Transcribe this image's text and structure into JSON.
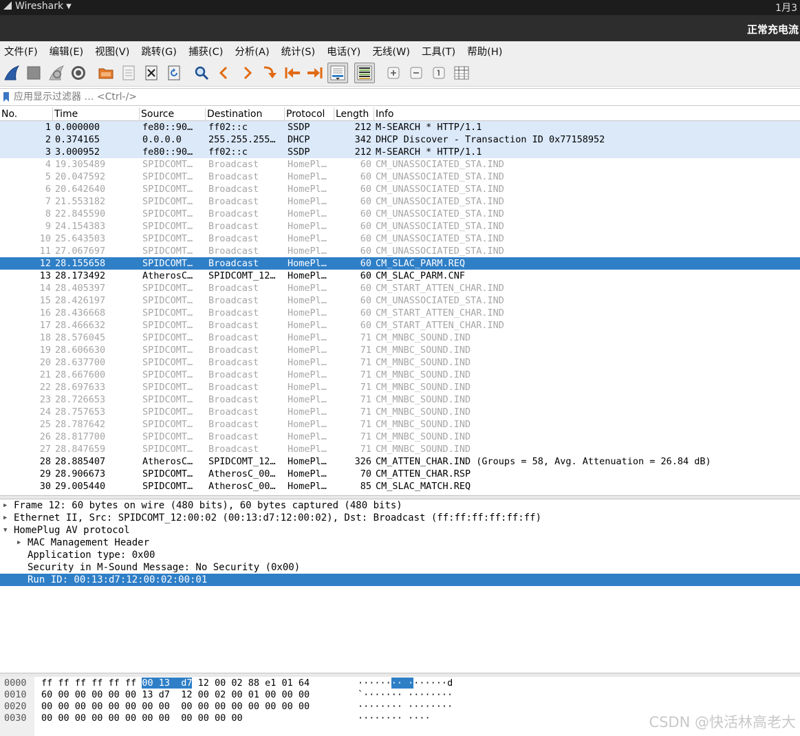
{
  "system": {
    "app_name": "Wireshark",
    "clock": "1月3"
  },
  "window": {
    "title": "正常充电流"
  },
  "menu": [
    "文件(F)",
    "编辑(E)",
    "视图(V)",
    "跳转(G)",
    "捕获(C)",
    "分析(A)",
    "统计(S)",
    "电话(Y)",
    "无线(W)",
    "工具(T)",
    "帮助(H)"
  ],
  "toolbar_icons": [
    "shark-fin-start-icon",
    "stop-square-icon",
    "restart-fin-icon",
    "gear-options-icon",
    "open-folder-icon",
    "save-file-icon",
    "close-file-icon",
    "reload-icon",
    "find-magnifier-icon",
    "arrow-left-icon",
    "arrow-right-icon",
    "jump-to-icon",
    "first-packet-icon",
    "last-packet-icon",
    "autoscroll-icon",
    "colorize-icon",
    "zoom-in-icon",
    "zoom-out-icon",
    "normal-size-icon",
    "resize-columns-icon"
  ],
  "filter": {
    "placeholder": "应用显示过滤器 … <Ctrl-/>",
    "value": ""
  },
  "packet_list": {
    "columns": [
      "No.",
      "Time",
      "Source",
      "Destination",
      "Protocol",
      "Length",
      "Info"
    ],
    "rows": [
      {
        "no": "1",
        "time": "0.000000",
        "src": "fe80::90…",
        "dst": "ff02::c",
        "proto": "SSDP",
        "len": "212",
        "info": "M-SEARCH * HTTP/1.1",
        "style": "udp"
      },
      {
        "no": "2",
        "time": "0.374165",
        "src": "0.0.0.0",
        "dst": "255.255.255…",
        "proto": "DHCP",
        "len": "342",
        "info": "DHCP Discover - Transaction ID 0x77158952",
        "style": "udp"
      },
      {
        "no": "3",
        "time": "3.000952",
        "src": "fe80::90…",
        "dst": "ff02::c",
        "proto": "SSDP",
        "len": "212",
        "info": "M-SEARCH * HTTP/1.1",
        "style": "udp"
      },
      {
        "no": "4",
        "time": "19.305489",
        "src": "SPIDCOMT…",
        "dst": "Broadcast",
        "proto": "HomePl…",
        "len": "60",
        "info": "CM_UNASSOCIATED_STA.IND",
        "style": "dim"
      },
      {
        "no": "5",
        "time": "20.047592",
        "src": "SPIDCOMT…",
        "dst": "Broadcast",
        "proto": "HomePl…",
        "len": "60",
        "info": "CM_UNASSOCIATED_STA.IND",
        "style": "dim"
      },
      {
        "no": "6",
        "time": "20.642640",
        "src": "SPIDCOMT…",
        "dst": "Broadcast",
        "proto": "HomePl…",
        "len": "60",
        "info": "CM_UNASSOCIATED_STA.IND",
        "style": "dim"
      },
      {
        "no": "7",
        "time": "21.553182",
        "src": "SPIDCOMT…",
        "dst": "Broadcast",
        "proto": "HomePl…",
        "len": "60",
        "info": "CM_UNASSOCIATED_STA.IND",
        "style": "dim"
      },
      {
        "no": "8",
        "time": "22.845590",
        "src": "SPIDCOMT…",
        "dst": "Broadcast",
        "proto": "HomePl…",
        "len": "60",
        "info": "CM_UNASSOCIATED_STA.IND",
        "style": "dim"
      },
      {
        "no": "9",
        "time": "24.154383",
        "src": "SPIDCOMT…",
        "dst": "Broadcast",
        "proto": "HomePl…",
        "len": "60",
        "info": "CM_UNASSOCIATED_STA.IND",
        "style": "dim"
      },
      {
        "no": "10",
        "time": "25.643503",
        "src": "SPIDCOMT…",
        "dst": "Broadcast",
        "proto": "HomePl…",
        "len": "60",
        "info": "CM_UNASSOCIATED_STA.IND",
        "style": "dim"
      },
      {
        "no": "11",
        "time": "27.067697",
        "src": "SPIDCOMT…",
        "dst": "Broadcast",
        "proto": "HomePl…",
        "len": "60",
        "info": "CM_UNASSOCIATED_STA.IND",
        "style": "dim"
      },
      {
        "no": "12",
        "time": "28.155658",
        "src": "SPIDCOMT…",
        "dst": "Broadcast",
        "proto": "HomePl…",
        "len": "60",
        "info": "CM_SLAC_PARM.REQ",
        "style": "sel"
      },
      {
        "no": "13",
        "time": "28.173492",
        "src": "AtherosC…",
        "dst": "SPIDCOMT_12…",
        "proto": "HomePl…",
        "len": "60",
        "info": "CM_SLAC_PARM.CNF",
        "style": "norm"
      },
      {
        "no": "14",
        "time": "28.405397",
        "src": "SPIDCOMT…",
        "dst": "Broadcast",
        "proto": "HomePl…",
        "len": "60",
        "info": "CM_START_ATTEN_CHAR.IND",
        "style": "dim"
      },
      {
        "no": "15",
        "time": "28.426197",
        "src": "SPIDCOMT…",
        "dst": "Broadcast",
        "proto": "HomePl…",
        "len": "60",
        "info": "CM_UNASSOCIATED_STA.IND",
        "style": "dim"
      },
      {
        "no": "16",
        "time": "28.436668",
        "src": "SPIDCOMT…",
        "dst": "Broadcast",
        "proto": "HomePl…",
        "len": "60",
        "info": "CM_START_ATTEN_CHAR.IND",
        "style": "dim"
      },
      {
        "no": "17",
        "time": "28.466632",
        "src": "SPIDCOMT…",
        "dst": "Broadcast",
        "proto": "HomePl…",
        "len": "60",
        "info": "CM_START_ATTEN_CHAR.IND",
        "style": "dim"
      },
      {
        "no": "18",
        "time": "28.576045",
        "src": "SPIDCOMT…",
        "dst": "Broadcast",
        "proto": "HomePl…",
        "len": "71",
        "info": "CM_MNBC_SOUND.IND",
        "style": "dim"
      },
      {
        "no": "19",
        "time": "28.606630",
        "src": "SPIDCOMT…",
        "dst": "Broadcast",
        "proto": "HomePl…",
        "len": "71",
        "info": "CM_MNBC_SOUND.IND",
        "style": "dim"
      },
      {
        "no": "20",
        "time": "28.637700",
        "src": "SPIDCOMT…",
        "dst": "Broadcast",
        "proto": "HomePl…",
        "len": "71",
        "info": "CM_MNBC_SOUND.IND",
        "style": "dim"
      },
      {
        "no": "21",
        "time": "28.667600",
        "src": "SPIDCOMT…",
        "dst": "Broadcast",
        "proto": "HomePl…",
        "len": "71",
        "info": "CM_MNBC_SOUND.IND",
        "style": "dim"
      },
      {
        "no": "22",
        "time": "28.697633",
        "src": "SPIDCOMT…",
        "dst": "Broadcast",
        "proto": "HomePl…",
        "len": "71",
        "info": "CM_MNBC_SOUND.IND",
        "style": "dim"
      },
      {
        "no": "23",
        "time": "28.726653",
        "src": "SPIDCOMT…",
        "dst": "Broadcast",
        "proto": "HomePl…",
        "len": "71",
        "info": "CM_MNBC_SOUND.IND",
        "style": "dim"
      },
      {
        "no": "24",
        "time": "28.757653",
        "src": "SPIDCOMT…",
        "dst": "Broadcast",
        "proto": "HomePl…",
        "len": "71",
        "info": "CM_MNBC_SOUND.IND",
        "style": "dim"
      },
      {
        "no": "25",
        "time": "28.787642",
        "src": "SPIDCOMT…",
        "dst": "Broadcast",
        "proto": "HomePl…",
        "len": "71",
        "info": "CM_MNBC_SOUND.IND",
        "style": "dim"
      },
      {
        "no": "26",
        "time": "28.817700",
        "src": "SPIDCOMT…",
        "dst": "Broadcast",
        "proto": "HomePl…",
        "len": "71",
        "info": "CM_MNBC_SOUND.IND",
        "style": "dim"
      },
      {
        "no": "27",
        "time": "28.847659",
        "src": "SPIDCOMT…",
        "dst": "Broadcast",
        "proto": "HomePl…",
        "len": "71",
        "info": "CM_MNBC_SOUND.IND",
        "style": "dim"
      },
      {
        "no": "28",
        "time": "28.885407",
        "src": "AtherosC…",
        "dst": "SPIDCOMT_12…",
        "proto": "HomePl…",
        "len": "326",
        "info": "CM_ATTEN_CHAR.IND (Groups = 58, Avg. Attenuation = 26.84 dB)",
        "style": "norm"
      },
      {
        "no": "29",
        "time": "28.906673",
        "src": "SPIDCOMT…",
        "dst": "AtherosC_00…",
        "proto": "HomePl…",
        "len": "70",
        "info": "CM_ATTEN_CHAR.RSP",
        "style": "norm"
      },
      {
        "no": "30",
        "time": "29.005440",
        "src": "SPIDCOMT…",
        "dst": "AtherosC_00…",
        "proto": "HomePl…",
        "len": "85",
        "info": "CM_SLAC_MATCH.REQ",
        "style": "norm"
      }
    ]
  },
  "details": [
    {
      "text": "Frame 12: 60 bytes on wire (480 bits), 60 bytes captured (480 bits)",
      "level": 0,
      "expander": "collapsed",
      "selected": false
    },
    {
      "text": "Ethernet II, Src: SPIDCOMT_12:00:02 (00:13:d7:12:00:02), Dst: Broadcast (ff:ff:ff:ff:ff:ff)",
      "level": 0,
      "expander": "collapsed",
      "selected": false
    },
    {
      "text": "HomePlug AV protocol",
      "level": 0,
      "expander": "expanded",
      "selected": false
    },
    {
      "text": "MAC Management Header",
      "level": 1,
      "expander": "collapsed",
      "selected": false
    },
    {
      "text": "Application type: 0x00",
      "level": 1,
      "expander": "none",
      "selected": false
    },
    {
      "text": "Security in M-Sound Message: No Security (0x00)",
      "level": 1,
      "expander": "none",
      "selected": false
    },
    {
      "text": "Run ID: 00:13:d7:12:00:02:00:01",
      "level": 1,
      "expander": "none",
      "selected": true
    }
  ],
  "hex": [
    {
      "offset": "0000",
      "bytes": [
        [
          "ff ff ff ff ff ff ",
          false
        ],
        [
          "00 13  d7",
          true
        ],
        [
          " 12 00 02 88 e1 01 64",
          false
        ]
      ],
      "ascii": [
        [
          "······",
          false
        ],
        [
          "·· ·",
          true
        ],
        [
          "······d",
          false
        ]
      ]
    },
    {
      "offset": "0010",
      "bytes": [
        [
          "60 00 00 00 00 00 13 d7  12 00 02 00 01 00 00 00",
          false
        ]
      ],
      "ascii": [
        [
          "`······· ········",
          false
        ]
      ]
    },
    {
      "offset": "0020",
      "bytes": [
        [
          "00 00 00 00 00 00 00 00  00 00 00 00 00 00 00 00",
          false
        ]
      ],
      "ascii": [
        [
          "········ ········",
          false
        ]
      ]
    },
    {
      "offset": "0030",
      "bytes": [
        [
          "00 00 00 00 00 00 00 00  00 00 00 00",
          false
        ]
      ],
      "ascii": [
        [
          "········ ····",
          false
        ]
      ]
    }
  ],
  "watermark": "CSDN @快活林高老大",
  "colors": {
    "selection": "#2f7fc7",
    "udp_row": "#dbe9f9",
    "dim_text": "#a6a6a6"
  }
}
